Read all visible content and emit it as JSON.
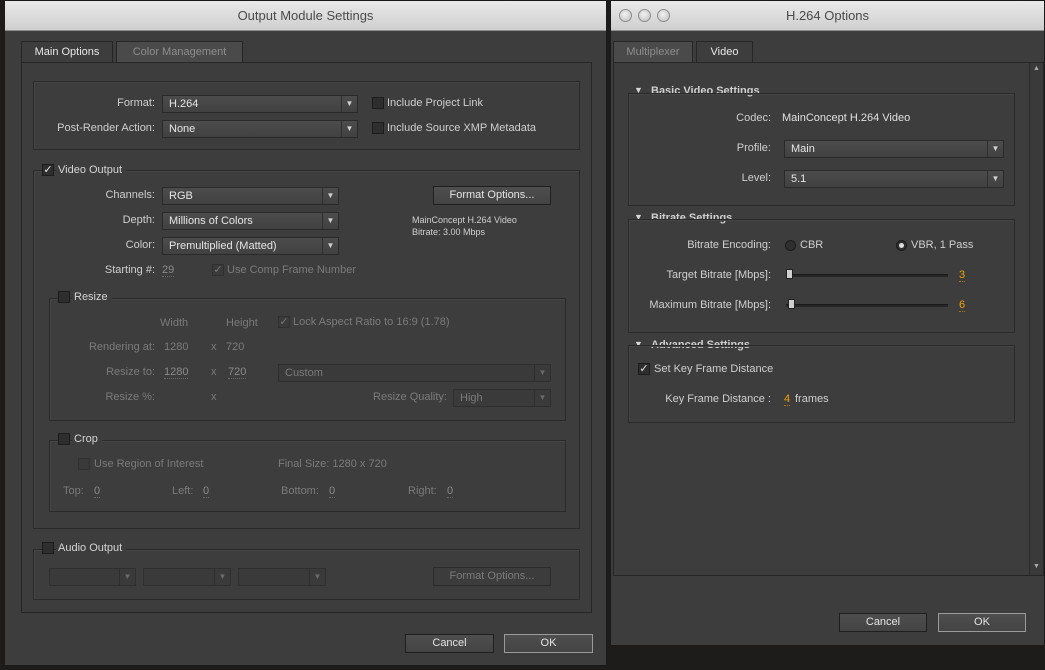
{
  "output_module": {
    "title": "Output Module Settings",
    "tabs": [
      "Main Options",
      "Color Management"
    ],
    "format_label": "Format:",
    "format_value": "H.264",
    "post_render_label": "Post-Render Action:",
    "post_render_value": "None",
    "include_project_link": "Include Project Link",
    "include_xmp": "Include Source XMP Metadata",
    "video_output": {
      "title": "Video Output",
      "channels_label": "Channels:",
      "channels_value": "RGB",
      "depth_label": "Depth:",
      "depth_value": "Millions of Colors",
      "color_label": "Color:",
      "color_value": "Premultiplied (Matted)",
      "starting_label": "Starting #:",
      "starting_value": "29",
      "use_comp_frame": "Use Comp Frame Number",
      "format_options": "Format Options...",
      "info_line1": "MainConcept H.264 Video",
      "info_line2": "Bitrate: 3.00 Mbps"
    },
    "resize": {
      "title": "Resize",
      "width_hdr": "Width",
      "height_hdr": "Height",
      "lock_aspect": "Lock Aspect Ratio to 16:9 (1.78)",
      "rendering_at_label": "Rendering at:",
      "rendering_w": "1280",
      "rendering_h": "720",
      "resize_to_label": "Resize to:",
      "resize_w": "1280",
      "resize_h": "720",
      "x": "x",
      "preset_value": "Custom",
      "resize_pct_label": "Resize %:",
      "quality_label": "Resize Quality:",
      "quality_value": "High"
    },
    "crop": {
      "title": "Crop",
      "use_roi": "Use Region of Interest",
      "final_size": "Final Size: 1280 x 720",
      "top_label": "Top:",
      "top_value": "0",
      "left_label": "Left:",
      "left_value": "0",
      "bottom_label": "Bottom:",
      "bottom_value": "0",
      "right_label": "Right:",
      "right_value": "0"
    },
    "audio": {
      "title": "Audio Output",
      "format_options": "Format Options..."
    },
    "cancel": "Cancel",
    "ok": "OK"
  },
  "h264": {
    "title": "H.264 Options",
    "tabs": [
      "Multiplexer",
      "Video"
    ],
    "basic": {
      "title": "Basic Video Settings",
      "codec_label": "Codec:",
      "codec_value": "MainConcept H.264 Video",
      "profile_label": "Profile:",
      "profile_value": "Main",
      "level_label": "Level:",
      "level_value": "5.1"
    },
    "bitrate": {
      "title": "Bitrate Settings",
      "encoding_label": "Bitrate Encoding:",
      "cbr": "CBR",
      "vbr": "VBR, 1 Pass",
      "target_label": "Target Bitrate [Mbps]:",
      "target_value": "3",
      "max_label": "Maximum Bitrate [Mbps]:",
      "max_value": "6"
    },
    "advanced": {
      "title": "Advanced Settings",
      "set_key_frame": "Set Key Frame Distance",
      "kfd_label": "Key Frame Distance :",
      "kfd_value": "4",
      "kfd_unit": "frames"
    },
    "cancel": "Cancel",
    "ok": "OK"
  }
}
